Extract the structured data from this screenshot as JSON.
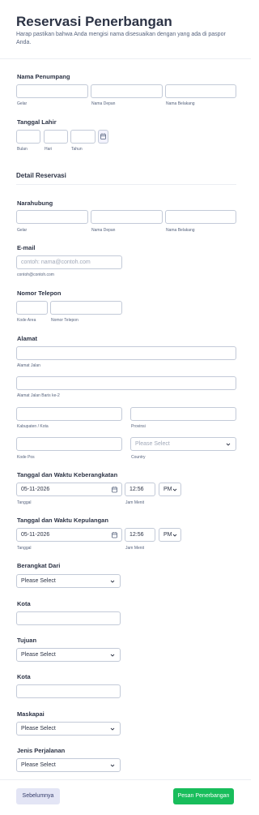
{
  "header": {
    "title": "Reservasi Penerbangan",
    "subtitle": "Harap pastikan bahwa Anda mengisi nama disesuaikan dengan yang ada di paspor Anda."
  },
  "passenger": {
    "label": "Nama Penumpang",
    "sub_title": "Gelar",
    "sub_first": "Nama Depan",
    "sub_last": "Nama Belakang"
  },
  "birth": {
    "label": "Tanggal Lahir",
    "sub_month": "Bulan",
    "sub_day": "Hari",
    "sub_year": "Tahun"
  },
  "reservation_heading": "Detail Reservasi",
  "contact": {
    "label": "Narahubung",
    "sub_title": "Gelar",
    "sub_first": "Nama Depan",
    "sub_last": "Nama Belakang"
  },
  "email": {
    "label": "E-mail",
    "placeholder": "contoh: nama@contoh.com",
    "sub": "contoh@contoh.com"
  },
  "phone": {
    "label": "Nomor Telepon",
    "sub_area": "Kode Area",
    "sub_number": "Nomor Telepon"
  },
  "address": {
    "label": "Alamat",
    "sub_street": "Alamat Jalan",
    "sub_street2": "Alamat Jalan Baris ke-2",
    "sub_city": "Kabupaten / Kota",
    "sub_province": "Provinsi",
    "sub_postal": "Kode Pos",
    "sub_country": "Country",
    "country_placeholder": "Please Select"
  },
  "departure": {
    "label": "Tanggal dan Waktu Keberangkatan",
    "date": "05-11-2026",
    "time": "12:56",
    "ampm": "PM",
    "sub_date": "Tanggal",
    "sub_time": "Jam Menit"
  },
  "return": {
    "label": "Tanggal dan Waktu Kepulangan",
    "date": "05-11-2026",
    "time": "12:56",
    "ampm": "PM",
    "sub_date": "Tanggal",
    "sub_time": "Jam Menit"
  },
  "from": {
    "label": "Berangkat Dari",
    "value": "Please Select"
  },
  "from_city": {
    "label": "Kota"
  },
  "destination": {
    "label": "Tujuan",
    "value": "Please Select"
  },
  "dest_city": {
    "label": "Kota"
  },
  "airline": {
    "label": "Maskapai",
    "value": "Please Select"
  },
  "trip_type": {
    "label": "Jenis Perjalanan",
    "value": "Please Select"
  },
  "buttons": {
    "prev": "Sebelumnya",
    "submit": "Pesan Penerbangan"
  },
  "icons": {
    "calendar": "calendar-icon",
    "chevron": "chevron-down-icon"
  },
  "colors": {
    "submit": "#18bd5b",
    "prev": "#e3e5f5",
    "text": "#2c3345"
  }
}
